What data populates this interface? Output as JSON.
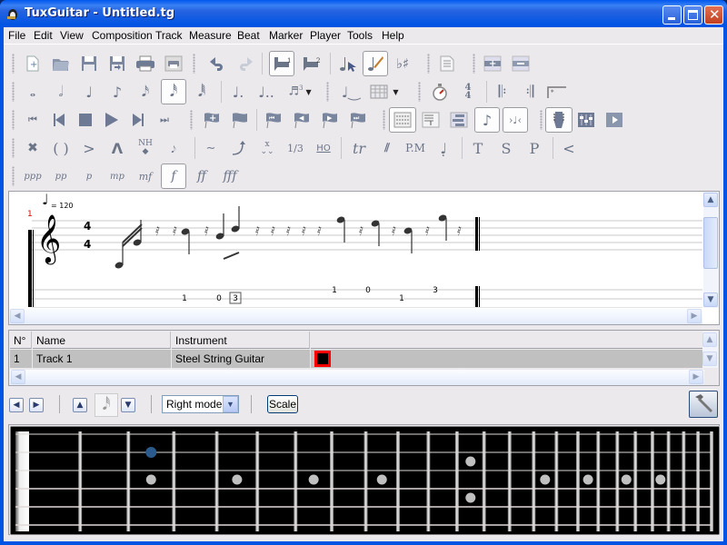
{
  "window": {
    "title": "TuxGuitar - Untitled.tg",
    "controls": [
      "minimize",
      "maximize",
      "close"
    ]
  },
  "menu": [
    "File",
    "Edit",
    "View",
    "Composition",
    "Track",
    "Measure",
    "Beat",
    "Marker",
    "Player",
    "Tools",
    "Help"
  ],
  "toolbar": {
    "row1": [
      "new-file",
      "open-file",
      "save",
      "save-as",
      "print",
      "print-preview",
      "undo",
      "redo",
      "voice-1",
      "voice-2",
      "select-mode",
      "edit-mode",
      "accidentals",
      "song-info",
      "insert-measure",
      "remove-measure"
    ],
    "row2": [
      "whole",
      "half",
      "quarter",
      "eighth",
      "sixteenth",
      "thirty-second",
      "sixty-fourth",
      "dotted",
      "double-dotted",
      "tuplet",
      "tied-note",
      "chord",
      "tempo",
      "time-signature",
      "repeat-open",
      "repeat-close",
      "alternative-ending"
    ],
    "row3": [
      "first",
      "previous",
      "stop",
      "play",
      "next",
      "last",
      "add-marker",
      "marker-list",
      "first-marker",
      "previous-marker",
      "next-marker",
      "last-marker",
      "score-view",
      "score-tab-view",
      "tablature-view",
      "note-view",
      "compact-view",
      "fretboard",
      "mixer",
      "transport"
    ],
    "row4": [
      "dead-note",
      "ghost-note",
      "accentuated-note",
      "heavy-accentuated",
      "harmonic",
      "grace-note",
      "vibrato",
      "bend",
      "tremolo-bar",
      "slide",
      "hammer-on",
      "trill",
      "tremolo-picking",
      "palm-mute",
      "staccato",
      "tapping",
      "slapping",
      "popping",
      "fade-in"
    ],
    "row4_labels": {
      "harmonic": "NH",
      "slide": "1/3",
      "hammer-on": "HO",
      "trill": "tr",
      "palm-mute": "P.M",
      "tapping": "T",
      "slapping": "S",
      "popping": "P",
      "fade-in": "<"
    },
    "dynamics": [
      "ppp",
      "pp",
      "p",
      "mp",
      "mf",
      "f",
      "ff",
      "fff"
    ],
    "selected_dynamic": "f",
    "selected_duration": "thirty-second"
  },
  "score": {
    "measure_number": "1",
    "tempo": "= 120",
    "time_signature": {
      "numerator": "4",
      "denominator": "4"
    },
    "tab_numbers": [
      {
        "fret": "1",
        "string": 5
      },
      {
        "fret": "0",
        "string": 5
      },
      {
        "fret": "3",
        "string": 5,
        "boxed": true
      },
      {
        "fret": "1",
        "string": 4
      },
      {
        "fret": "0",
        "string": 4
      },
      {
        "fret": "1",
        "string": 5
      },
      {
        "fret": "3",
        "string": 4
      }
    ]
  },
  "tracks": {
    "headers": [
      "N°",
      "Name",
      "Instrument",
      ""
    ],
    "rows": [
      {
        "number": "1",
        "name": "Track 1",
        "instrument": "Steel String Guitar",
        "color": "#000000"
      }
    ]
  },
  "fretboard_toolbar": {
    "mode": "Right mode",
    "scale_label": "Scale"
  },
  "fretboard": {
    "frets": 24,
    "strings": 6,
    "selected_note": {
      "string": 2,
      "fret": 3
    },
    "colors": {
      "selected": "#2b5a8c",
      "marker": "#c0c0c0"
    }
  }
}
